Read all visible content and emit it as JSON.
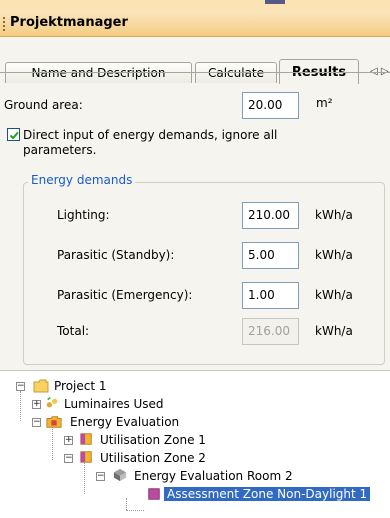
{
  "window": {
    "title": "Projektmanager"
  },
  "tabs": [
    {
      "label": "Name and Description",
      "active": false
    },
    {
      "label": "Calculate",
      "active": false
    },
    {
      "label": "Results",
      "active": true
    }
  ],
  "tab_scroll_glyph": "◁ ▷",
  "ground_area": {
    "label": "Ground area:",
    "value": "20.00",
    "unit": "m²"
  },
  "direct_input": {
    "checked": true,
    "label_line1": "Direct input of energy demands, ignore all",
    "label_line2": "parameters."
  },
  "energy_demands": {
    "title": "Energy demands",
    "rows": [
      {
        "label": "Lighting:",
        "value": "210.00",
        "unit": "kWh/a",
        "enabled": true
      },
      {
        "label": "Parasitic (Standby):",
        "value": "5.00",
        "unit": "kWh/a",
        "enabled": true
      },
      {
        "label": "Parasitic (Emergency):",
        "value": "1.00",
        "unit": "kWh/a",
        "enabled": true
      },
      {
        "label": "Total:",
        "value": "216.00",
        "unit": "kWh/a",
        "enabled": false
      }
    ]
  },
  "tree": {
    "items": [
      {
        "label": "Project 1",
        "icon": "folder-icon",
        "expander": "−"
      },
      {
        "label": "Luminaires Used",
        "icon": "luminaires-icon",
        "expander": "+"
      },
      {
        "label": "Energy Evaluation",
        "icon": "energy-evaluation-icon",
        "expander": "−"
      },
      {
        "label": "Utilisation Zone 1",
        "icon": "utilisation-zone-icon",
        "expander": "+"
      },
      {
        "label": "Utilisation Zone 2",
        "icon": "utilisation-zone-icon",
        "expander": "−"
      },
      {
        "label": "Energy Evaluation Room 2",
        "icon": "room-icon",
        "expander": "−"
      },
      {
        "label": "Assessment Zone Non-Daylight 1",
        "icon": "assessment-zone-icon",
        "selected": true
      }
    ]
  },
  "colors": {
    "accent": "#1a5bc9",
    "selection": "#316ac5",
    "titlebar": "#f3cd82"
  }
}
